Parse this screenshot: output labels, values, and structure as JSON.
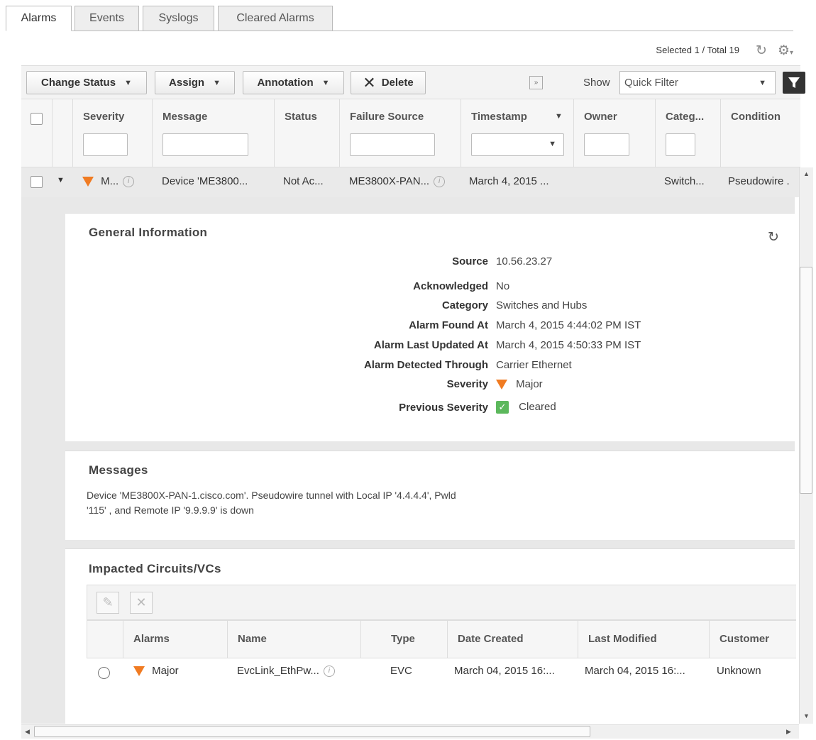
{
  "tabs": [
    "Alarms",
    "Events",
    "Syslogs",
    "Cleared Alarms"
  ],
  "selection": "Selected 1 / Total 19",
  "toolbar": {
    "change_status": "Change Status",
    "assign": "Assign",
    "annotation": "Annotation",
    "delete": "Delete",
    "show_label": "Show",
    "filter_value": "Quick Filter"
  },
  "columns": [
    "Severity",
    "Message",
    "Status",
    "Failure Source",
    "Timestamp",
    "Owner",
    "Categ...",
    "Condition"
  ],
  "row": {
    "severity": "M...",
    "message": "Device 'ME3800...",
    "status": "Not Ac...",
    "failure_source": "ME3800X-PAN...",
    "timestamp": "March 4, 2015 ...",
    "category": "Switch...",
    "condition": "Pseudowire ."
  },
  "general": {
    "title": "General Information",
    "source_k": "Source",
    "source_v": "10.56.23.27",
    "ack_k": "Acknowledged",
    "ack_v": "No",
    "cat_k": "Category",
    "cat_v": "Switches and Hubs",
    "found_k": "Alarm Found At",
    "found_v": "March 4, 2015 4:44:02 PM IST",
    "updated_k": "Alarm Last Updated At",
    "updated_v": "March 4, 2015 4:50:33 PM IST",
    "detected_k": "Alarm Detected Through",
    "detected_v": "Carrier Ethernet",
    "sev_k": "Severity",
    "sev_v": "Major",
    "prev_k": "Previous Severity",
    "prev_v": "Cleared"
  },
  "messages": {
    "title": "Messages",
    "text": "Device 'ME3800X-PAN-1.cisco.com'. Pseudowire tunnel with Local IP '4.4.4.4', Pwld '115' , and Remote IP '9.9.9.9' is down"
  },
  "impacted": {
    "title": "Impacted Circuits/VCs",
    "columns": [
      "Alarms",
      "Name",
      "Type",
      "Date Created",
      "Last Modified",
      "Customer"
    ],
    "row": {
      "alarm": "Major",
      "name": "EvcLink_EthPw...",
      "type": "EVC",
      "created": "March 04, 2015 16:...",
      "modified": "March 04, 2015 16:...",
      "customer": "Unknown"
    }
  },
  "colors": {
    "major": "#f07b22",
    "cleared": "#5cb85c"
  }
}
